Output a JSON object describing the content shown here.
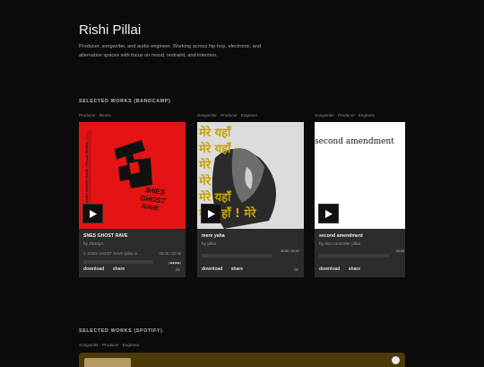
{
  "profile": {
    "name": "Rishi Pillai",
    "bio": "Producer, songwriter, and audio engineer. Working across hip-hop, electronic, and alternative spaces with focus on mood, restraint, and intention."
  },
  "bandcamp": {
    "title": "SELECTED WORKS (BANDCAMP)",
    "cards": [
      {
        "role": "Producer · Remix",
        "title": "SNES GHOST RAVE",
        "artist": "by ZEEQA",
        "track": "1.  SNES GHOST RAVE (pillai re...",
        "time": "00:00 / 02:08",
        "controls": "|◀◀  ▶▶|",
        "download": "download",
        "share": "share",
        "brand": "bc",
        "art_text_main": "SNES GHOST RAVE",
        "art_text_small": "SNES GHOST RAVE · PILLAI REMIX",
        "color": "#e41414"
      },
      {
        "role": "Songwriter · Producer · Engineer",
        "title": "mere yaha",
        "artist": "by pillai",
        "time": "00:00 / 01:57",
        "download": "download",
        "share": "share",
        "brand": "bc",
        "art_text": "मेरे यहाँ"
      },
      {
        "role": "Songwriter · Producer · Engineer",
        "title": "second amendment",
        "artist": "by mic controller pillai",
        "time": "00:00",
        "download": "download",
        "share": "share",
        "art_text": "second amendment"
      }
    ]
  },
  "spotify": {
    "title": "SELECTED WORKS (SPOTIFY)",
    "role": "Songwriter · Producer · Engineer"
  },
  "colors": {
    "background": "#0b0b0b",
    "card": "#2c2c2c",
    "red_art": "#e41414",
    "spotify_bar": "#4a3b09"
  }
}
